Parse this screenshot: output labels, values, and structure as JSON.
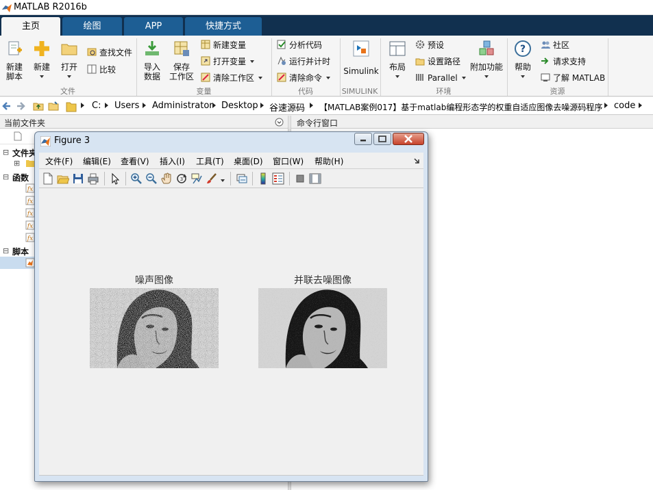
{
  "app": {
    "title": "MATLAB R2016b"
  },
  "tabs": [
    {
      "label": "主页",
      "active": true
    },
    {
      "label": "绘图",
      "active": false
    },
    {
      "label": "APP",
      "active": false
    },
    {
      "label": "快捷方式",
      "active": false
    }
  ],
  "ribbon": {
    "groups": {
      "file": "文件",
      "variable": "变量",
      "code": "代码",
      "simulink": "SIMULINK",
      "environment": "环境",
      "resources": "资源"
    },
    "new_script": [
      "新建",
      "脚本"
    ],
    "new": "新建",
    "open": "打开",
    "find_files": "查找文件",
    "compare": "比较",
    "import_data": [
      "导入",
      "数据"
    ],
    "save_workspace": [
      "保存",
      "工作区"
    ],
    "new_variable": "新建变量",
    "open_variable": "打开变量",
    "clear_workspace": "清除工作区",
    "analyze_code": "分析代码",
    "run_and_time": "运行并计时",
    "clear_commands": "清除命令",
    "simulink": "Simulink",
    "layout": "布局",
    "preferences": "预设",
    "set_path": "设置路径",
    "parallel": "Parallel",
    "addons": "附加功能",
    "help": "帮助",
    "community": "社区",
    "request_support": "请求支持",
    "learn_matlab": "了解 MATLAB"
  },
  "address": {
    "crumbs": [
      "C:",
      "Users",
      "Administrator",
      "Desktop",
      "谷速源码",
      "【MATLAB案例017】基于matlab编程形态学的权重自适应图像去噪源码程序",
      "code"
    ]
  },
  "panels": {
    "current_folder": "当前文件夹",
    "command_window": "命令行窗口",
    "tree": {
      "folder_section": "文件夹",
      "functions": "函数",
      "scripts": "脚本"
    }
  },
  "figure": {
    "title": "Figure 3",
    "menu": [
      "文件(F)",
      "编辑(E)",
      "查看(V)",
      "插入(I)",
      "工具(T)",
      "桌面(D)",
      "窗口(W)",
      "帮助(H)"
    ],
    "axes": [
      {
        "title": "噪声图像"
      },
      {
        "title": "并联去噪图像"
      }
    ]
  },
  "colors": {
    "tab_strip": "#11304f",
    "tab": "#1d5e94",
    "ribbon": "#f5f5f5"
  }
}
